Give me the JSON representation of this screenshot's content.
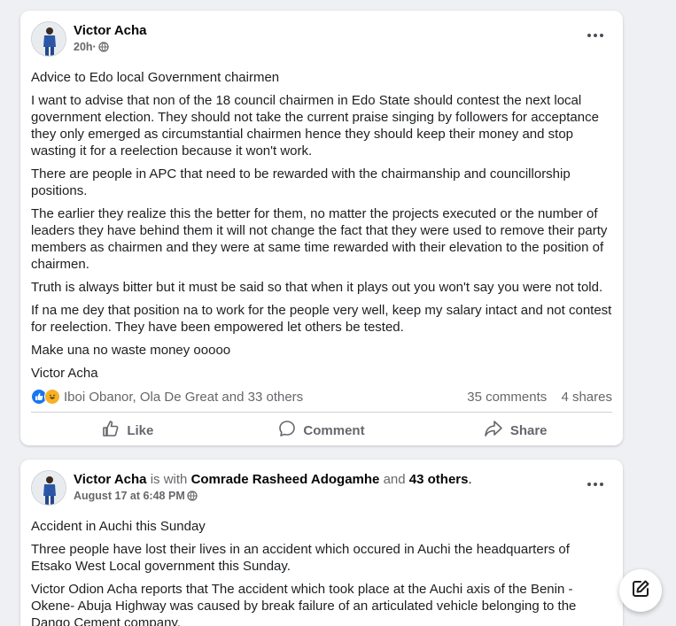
{
  "posts": [
    {
      "author": "Victor Acha",
      "time": "20h",
      "visibility_icon": "globe-icon",
      "paragraphs": [
        "Advice to Edo local Government chairmen",
        "I want to advise that non of the 18 council chairmen in Edo State should contest the next local government election. They should not take the current praise singing by followers for acceptance they only emerged as circumstantial chairmen hence they should keep their money and stop wasting it for a reelection because it won't work.",
        "There are people in APC that need to be rewarded with the chairmanship and councillorship positions.",
        "The earlier they realize this the better for them, no matter the projects executed or the number of leaders they have behind them it will not change the fact that they were used to remove their party members as chairmen and they were at same time rewarded with their elevation to the position of chairmen.",
        "Truth is always bitter but it must be said so that when it plays out you won't say you were not told.",
        "If na me dey that position na to work for the people very well, keep my salary intact and not contest for reelection. They have been empowered let others be tested.",
        "Make una no waste money ooooo",
        "Victor Acha"
      ],
      "reactions": {
        "icons": [
          "like-reaction-icon",
          "haha-reaction-icon"
        ],
        "names": "Iboi Obanor, Ola De Great and 33 others"
      },
      "comments": "35 comments",
      "shares": "4 shares"
    },
    {
      "author": "Victor Acha",
      "with_word": "is with",
      "tagged": "Comrade Rasheed Adogamhe",
      "and_word": "and",
      "others": "43 others",
      "period": ".",
      "time": "August 17 at 6:48 PM",
      "visibility_icon": "globe-icon",
      "paragraphs": [
        "Accident in Auchi this Sunday",
        "Three people have lost their lives in an accident which occured in Auchi the headquarters of Etsako West Local government this Sunday.",
        "Victor Odion Acha reports that The accident which  took place at the Auchi axis of the Benin -Okene- Abuja Highway was caused by break failure of an articulated vehicle belonging to the Dango Cement company."
      ]
    }
  ],
  "actions": {
    "like": "Like",
    "comment": "Comment",
    "share": "Share"
  },
  "fab_icon": "compose-icon"
}
